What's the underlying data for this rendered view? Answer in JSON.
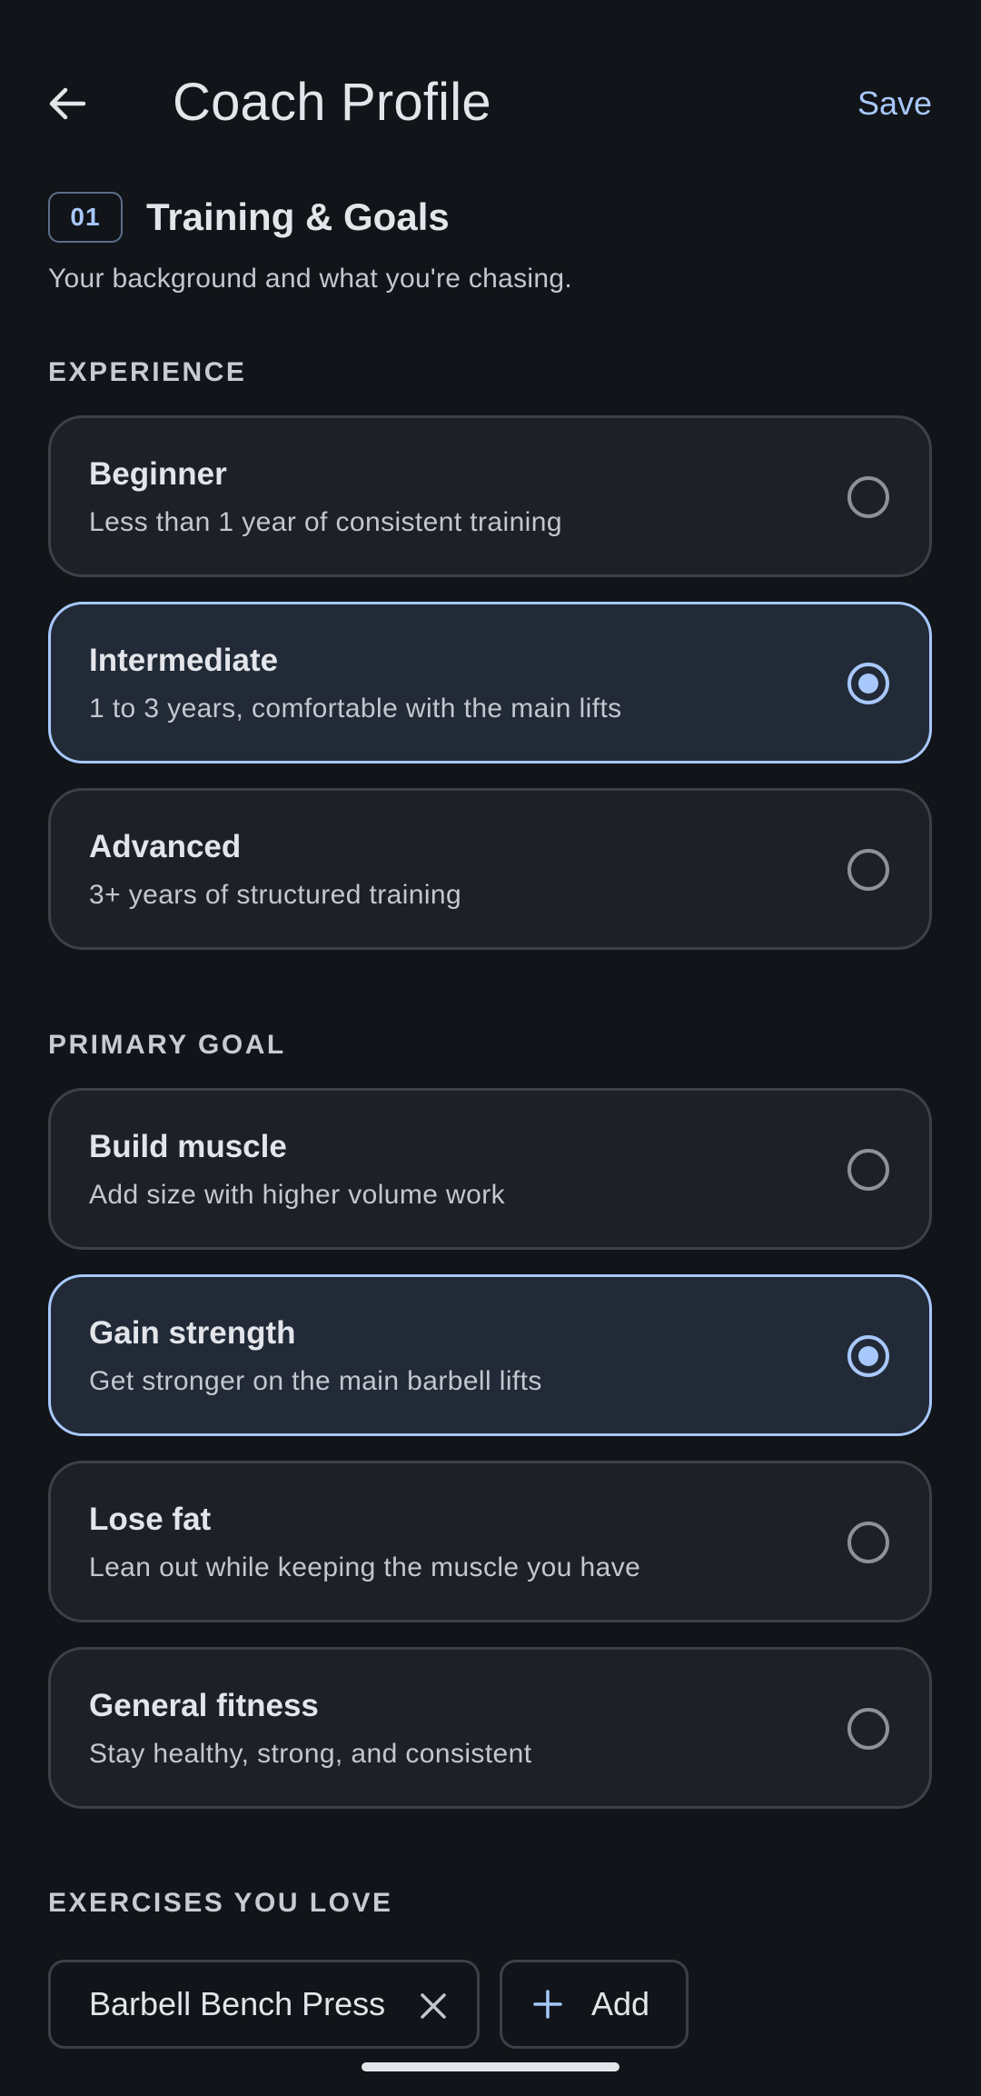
{
  "appbar": {
    "title": "Coach Profile",
    "save_label": "Save",
    "back_icon": "arrow-left-icon"
  },
  "section": {
    "step": "01",
    "title": "Training & Goals",
    "subtitle": "Your background and what you're chasing."
  },
  "experience": {
    "label": "EXPERIENCE",
    "options": [
      {
        "title": "Beginner",
        "desc": "Less than 1 year of consistent training",
        "selected": false
      },
      {
        "title": "Intermediate",
        "desc": "1 to 3 years, comfortable with the main lifts",
        "selected": true
      },
      {
        "title": "Advanced",
        "desc": "3+ years of structured training",
        "selected": false
      }
    ]
  },
  "goal": {
    "label": "PRIMARY GOAL",
    "options": [
      {
        "title": "Build muscle",
        "desc": "Add size with higher volume work",
        "selected": false
      },
      {
        "title": "Gain strength",
        "desc": "Get stronger on the main barbell lifts",
        "selected": true
      },
      {
        "title": "Lose fat",
        "desc": "Lean out while keeping the muscle you have",
        "selected": false
      },
      {
        "title": "General fitness",
        "desc": "Stay healthy, strong, and consistent",
        "selected": false
      }
    ]
  },
  "favorites": {
    "label": "EXERCISES YOU LOVE",
    "chips": [
      {
        "label": "Barbell Bench Press",
        "icon": "close-icon"
      }
    ],
    "add_label": "Add",
    "add_icon": "plus-icon"
  },
  "colors": {
    "background": "#111418",
    "accent": "#a8c8fb",
    "card": "#1d2027",
    "card_selected": "#212a36",
    "border": "#3d4048"
  }
}
